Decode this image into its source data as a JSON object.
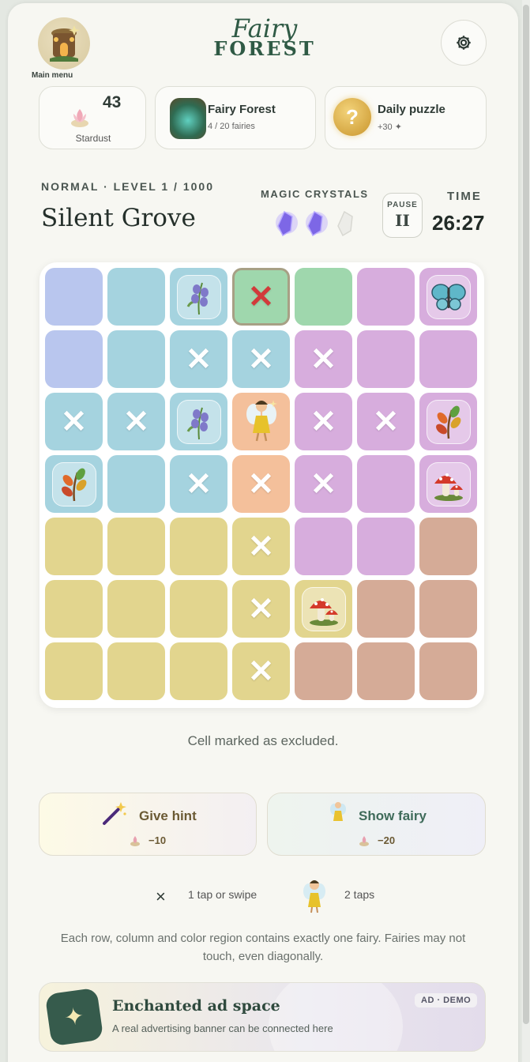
{
  "header": {
    "menu_label": "Main menu",
    "logo_top": "Fairy",
    "logo_bottom": "FOREST",
    "settings_icon": "gear-icon"
  },
  "cards": {
    "stardust_value": "43",
    "stardust_label": "Stardust",
    "forest_title": "Fairy Forest",
    "forest_sub": "4 / 20 fairies",
    "daily_title": "Daily puzzle",
    "daily_sub": "+30 ✦",
    "daily_icon_glyph": "?"
  },
  "level": {
    "caption": "NORMAL · LEVEL 1 / 1000",
    "name": "Silent Grove",
    "crystals_label": "MAGIC CRYSTALS",
    "crystals_total": 3,
    "crystals_filled": 2,
    "pause_label": "PAUSE",
    "pause_icon_glyph": "II",
    "time_label": "TIME",
    "time_value": "26:27"
  },
  "board": {
    "size": 7,
    "region_colors": {
      "B": "#b9c6ee",
      "C": "#a5d3df",
      "G": "#9fd7ad",
      "P": "#d7addd",
      "O": "#f4c09b",
      "Y": "#e2d58e",
      "R": "#d5ab97"
    },
    "regions": [
      "BCCGGPP",
      "BCCCPPP",
      "CCCOPPP",
      "CCCOPPP",
      "YYYYPPR",
      "YYYYYRR",
      "YYYYRRR"
    ],
    "cells": [
      [
        "",
        "",
        "bluebell",
        "x-red",
        "",
        "",
        "butterfly"
      ],
      [
        "",
        "",
        "x",
        "x",
        "x",
        "",
        ""
      ],
      [
        "x",
        "x",
        "bluebell",
        "fairy",
        "x",
        "x",
        "leaf"
      ],
      [
        "leaf",
        "",
        "x",
        "x",
        "x",
        "",
        "mushroom"
      ],
      [
        "",
        "",
        "",
        "x",
        "",
        "",
        ""
      ],
      [
        "",
        "",
        "",
        "x",
        "mushroom",
        "",
        ""
      ],
      [
        "",
        "",
        "",
        "x",
        "",
        "",
        ""
      ]
    ],
    "selected_cell": [
      0,
      3
    ]
  },
  "status": "Cell marked as excluded.",
  "actions": {
    "hint_label": "Give hint",
    "hint_cost": "−10",
    "show_fairy_label": "Show fairy",
    "show_fairy_cost": "−20"
  },
  "legend": {
    "x_glyph": "×",
    "x_text": "1 tap or swipe",
    "fairy_text": "2 taps"
  },
  "rules": "Each row, column and color region contains exactly one fairy. Fairies may not touch, even diagonally.",
  "ad": {
    "title": "Enchanted ad space",
    "subtitle": "A real advertising banner can be connected here",
    "tag": "AD · DEMO",
    "icon_glyph": "✦"
  }
}
